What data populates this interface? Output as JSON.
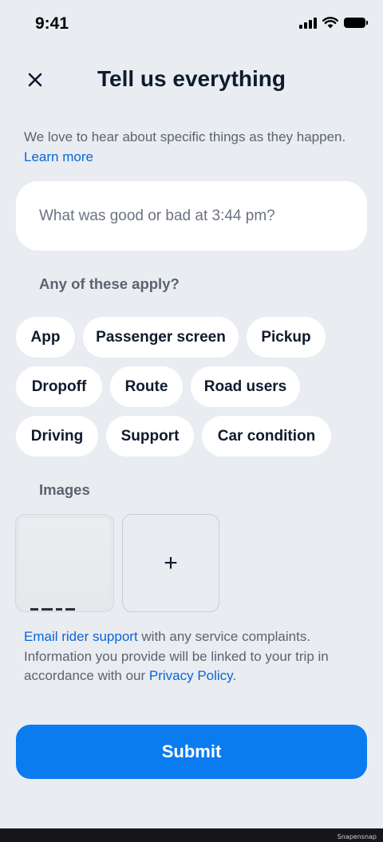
{
  "status_bar": {
    "time": "9:41"
  },
  "header": {
    "title": "Tell us everything"
  },
  "intro": {
    "text": "We love to hear about specific things as they happen.",
    "link": "Learn more"
  },
  "feedback_input": {
    "placeholder": "What was good or bad at 3:44 pm?",
    "value": ""
  },
  "categories": {
    "label": "Any of these apply?",
    "chips": [
      "App",
      "Passenger screen",
      "Pickup",
      "Dropoff",
      "Route",
      "Road users",
      "Driving",
      "Support",
      "Car condition"
    ]
  },
  "images": {
    "label": "Images",
    "add_symbol": "+"
  },
  "footer": {
    "support_link": "Email rider support",
    "text_1": "with any service complaints. Information you provide will be linked to your trip in accordance with our",
    "privacy_link": "Privacy Policy",
    "period": "."
  },
  "submit": {
    "label": "Submit"
  },
  "watermark": "Snapensnap",
  "colors": {
    "background": "#e9ecf1",
    "accent": "#0a7cf0",
    "link": "#0866d6",
    "text": "#0f1b2d",
    "muted": "#5b6470"
  }
}
